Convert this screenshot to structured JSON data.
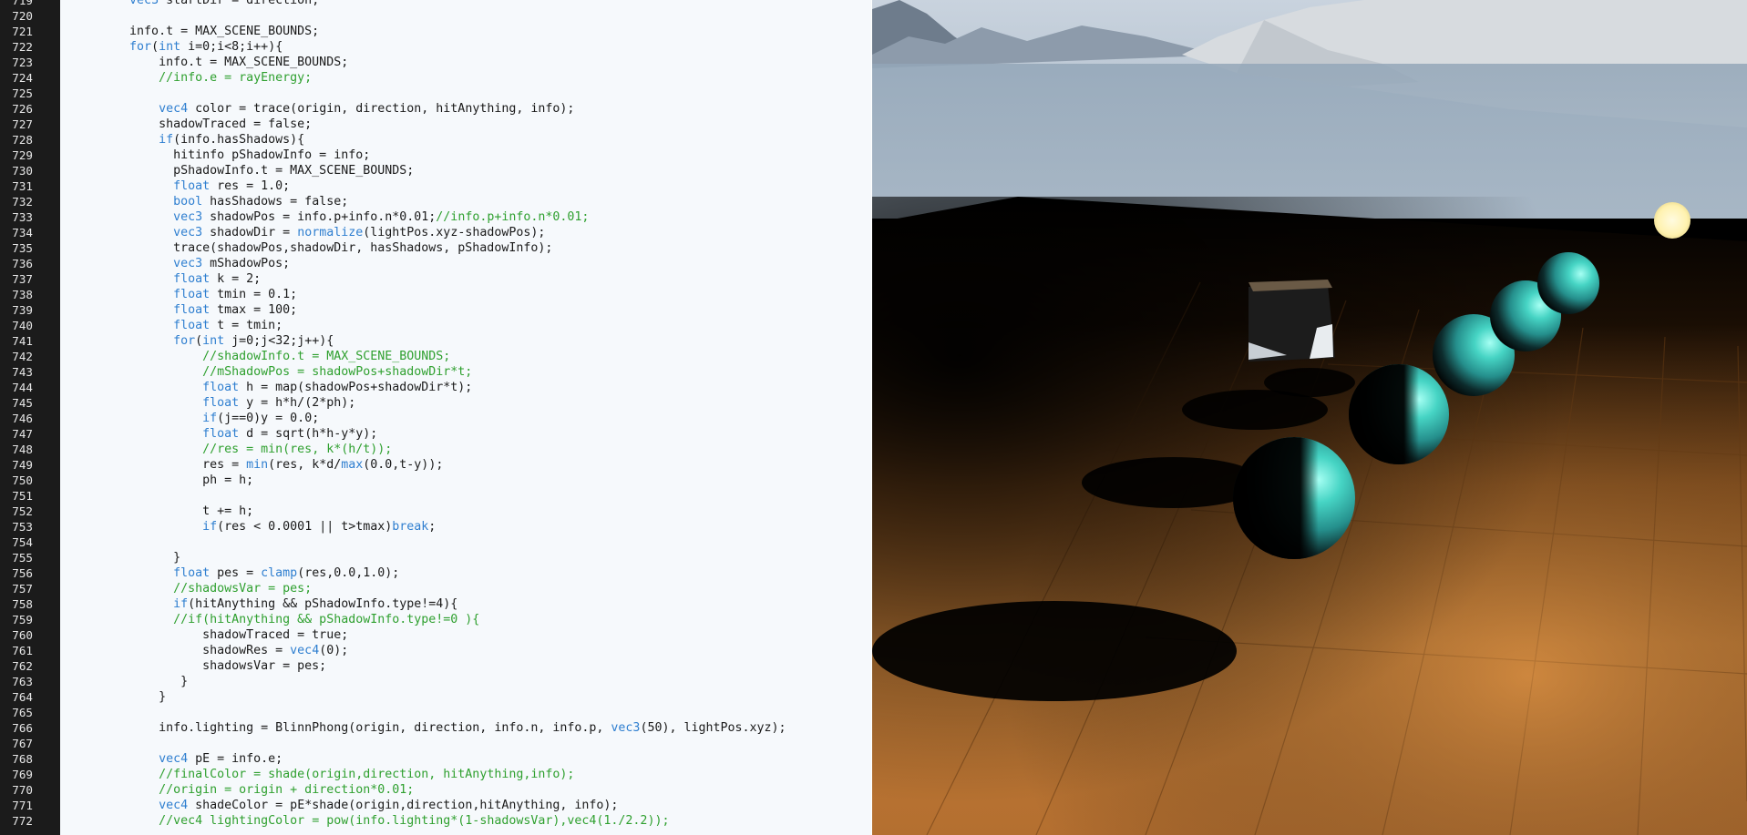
{
  "editor": {
    "first_line": 719,
    "lines": [
      [
        {
          "t": "        "
        },
        {
          "t": "vec3",
          "k": "kw"
        },
        {
          "t": " startDir = direction;"
        }
      ],
      [],
      [
        {
          "t": "        info.t = MAX_SCENE_BOUNDS;"
        }
      ],
      [
        {
          "t": "        "
        },
        {
          "t": "for",
          "k": "kw"
        },
        {
          "t": "("
        },
        {
          "t": "int",
          "k": "kw"
        },
        {
          "t": " i=0;i<8;i++){"
        }
      ],
      [
        {
          "t": "            info.t = MAX_SCENE_BOUNDS;"
        }
      ],
      [
        {
          "t": "            "
        },
        {
          "t": "//info.e = rayEnergy;",
          "k": "cm"
        }
      ],
      [],
      [
        {
          "t": "            "
        },
        {
          "t": "vec4",
          "k": "kw"
        },
        {
          "t": " color = trace(origin, direction, hitAnything, info);"
        }
      ],
      [
        {
          "t": "            shadowTraced = false;"
        }
      ],
      [
        {
          "t": "            "
        },
        {
          "t": "if",
          "k": "kw"
        },
        {
          "t": "(info.hasShadows){"
        }
      ],
      [
        {
          "t": "              hitinfo pShadowInfo = info;"
        }
      ],
      [
        {
          "t": "              pShadowInfo.t = MAX_SCENE_BOUNDS;"
        }
      ],
      [
        {
          "t": "              "
        },
        {
          "t": "float",
          "k": "kw"
        },
        {
          "t": " res = 1.0;"
        }
      ],
      [
        {
          "t": "              "
        },
        {
          "t": "bool",
          "k": "kw"
        },
        {
          "t": " hasShadows = false;"
        }
      ],
      [
        {
          "t": "              "
        },
        {
          "t": "vec3",
          "k": "kw"
        },
        {
          "t": " shadowPos = info.p+info.n*0.01;"
        },
        {
          "t": "//info.p+info.n*0.01;",
          "k": "cm"
        }
      ],
      [
        {
          "t": "              "
        },
        {
          "t": "vec3",
          "k": "kw"
        },
        {
          "t": " shadowDir = "
        },
        {
          "t": "normalize",
          "k": "kw"
        },
        {
          "t": "(lightPos.xyz-shadowPos);"
        }
      ],
      [
        {
          "t": "              trace(shadowPos,shadowDir, hasShadows, pShadowInfo);"
        }
      ],
      [
        {
          "t": "              "
        },
        {
          "t": "vec3",
          "k": "kw"
        },
        {
          "t": " mShadowPos;"
        }
      ],
      [
        {
          "t": "              "
        },
        {
          "t": "float",
          "k": "kw"
        },
        {
          "t": " k = 2;"
        }
      ],
      [
        {
          "t": "              "
        },
        {
          "t": "float",
          "k": "kw"
        },
        {
          "t": " tmin = 0.1;"
        }
      ],
      [
        {
          "t": "              "
        },
        {
          "t": "float",
          "k": "kw"
        },
        {
          "t": " tmax = 100;"
        }
      ],
      [
        {
          "t": "              "
        },
        {
          "t": "float",
          "k": "kw"
        },
        {
          "t": " t = tmin;"
        }
      ],
      [
        {
          "t": "              "
        },
        {
          "t": "for",
          "k": "kw"
        },
        {
          "t": "("
        },
        {
          "t": "int",
          "k": "kw"
        },
        {
          "t": " j=0;j<32;j++){"
        }
      ],
      [
        {
          "t": "                  "
        },
        {
          "t": "//shadowInfo.t = MAX_SCENE_BOUNDS;",
          "k": "cm"
        }
      ],
      [
        {
          "t": "                  "
        },
        {
          "t": "//mShadowPos = shadowPos+shadowDir*t;",
          "k": "cm"
        }
      ],
      [
        {
          "t": "                  "
        },
        {
          "t": "float",
          "k": "kw"
        },
        {
          "t": " h = map(shadowPos+shadowDir*t);"
        }
      ],
      [
        {
          "t": "                  "
        },
        {
          "t": "float",
          "k": "kw"
        },
        {
          "t": " y = h*h/(2*ph);"
        }
      ],
      [
        {
          "t": "                  "
        },
        {
          "t": "if",
          "k": "kw"
        },
        {
          "t": "(j==0)y = 0.0;"
        }
      ],
      [
        {
          "t": "                  "
        },
        {
          "t": "float",
          "k": "kw"
        },
        {
          "t": " d = sqrt(h*h-y*y);"
        }
      ],
      [
        {
          "t": "                  "
        },
        {
          "t": "//res = min(res, k*(h/t));",
          "k": "cm"
        }
      ],
      [
        {
          "t": "                  res = "
        },
        {
          "t": "min",
          "k": "kw"
        },
        {
          "t": "(res, k*d/"
        },
        {
          "t": "max",
          "k": "kw"
        },
        {
          "t": "(0.0,t-y));"
        }
      ],
      [
        {
          "t": "                  ph = h;"
        }
      ],
      [],
      [
        {
          "t": "                  t += h;"
        }
      ],
      [
        {
          "t": "                  "
        },
        {
          "t": "if",
          "k": "kw"
        },
        {
          "t": "(res < 0.0001 || t>tmax)"
        },
        {
          "t": "break",
          "k": "kw"
        },
        {
          "t": ";"
        }
      ],
      [],
      [
        {
          "t": "              }"
        }
      ],
      [
        {
          "t": "              "
        },
        {
          "t": "float",
          "k": "kw"
        },
        {
          "t": " pes = "
        },
        {
          "t": "clamp",
          "k": "kw"
        },
        {
          "t": "(res,0.0,1.0);"
        }
      ],
      [
        {
          "t": "              "
        },
        {
          "t": "//shadowsVar = pes;",
          "k": "cm"
        }
      ],
      [
        {
          "t": "              "
        },
        {
          "t": "if",
          "k": "kw"
        },
        {
          "t": "(hitAnything && pShadowInfo.type!=4){"
        }
      ],
      [
        {
          "t": "              "
        },
        {
          "t": "//if(hitAnything && pShadowInfo.type!=0 ){",
          "k": "cm"
        }
      ],
      [
        {
          "t": "                  shadowTraced = true;"
        }
      ],
      [
        {
          "t": "                  shadowRes = "
        },
        {
          "t": "vec4",
          "k": "kw"
        },
        {
          "t": "(0);"
        }
      ],
      [
        {
          "t": "                  shadowsVar = pes;"
        }
      ],
      [
        {
          "t": "               }"
        }
      ],
      [
        {
          "t": "            }"
        }
      ],
      [],
      [
        {
          "t": "            info.lighting = BlinnPhong(origin, direction, info.n, info.p, "
        },
        {
          "t": "vec3",
          "k": "kw"
        },
        {
          "t": "(50), lightPos.xyz);"
        }
      ],
      [],
      [
        {
          "t": "            "
        },
        {
          "t": "vec4",
          "k": "kw"
        },
        {
          "t": " pE = info.e;"
        }
      ],
      [
        {
          "t": "            "
        },
        {
          "t": "//finalColor = shade(origin,direction, hitAnything,info);",
          "k": "cm"
        }
      ],
      [
        {
          "t": "            "
        },
        {
          "t": "//origin = origin + direction*0.01;",
          "k": "cm"
        }
      ],
      [
        {
          "t": "            "
        },
        {
          "t": "vec4",
          "k": "kw"
        },
        {
          "t": " shadeColor = pE*shade(origin,direction,hitAnything, info);"
        }
      ],
      [
        {
          "t": "            "
        },
        {
          "t": "//vec4 lightingColor = pow(info.lighting*(1-shadowsVar),vec4(1./2.2));",
          "k": "cm"
        }
      ]
    ]
  },
  "render": {
    "scene": "raytraced-spheres-on-wood-floor",
    "sphere_count": 5,
    "sky_color": "#b8c6d4",
    "floor_color": "#b8722f",
    "sphere_color": "#3fd1c1",
    "light_color": "#fff4b8"
  }
}
